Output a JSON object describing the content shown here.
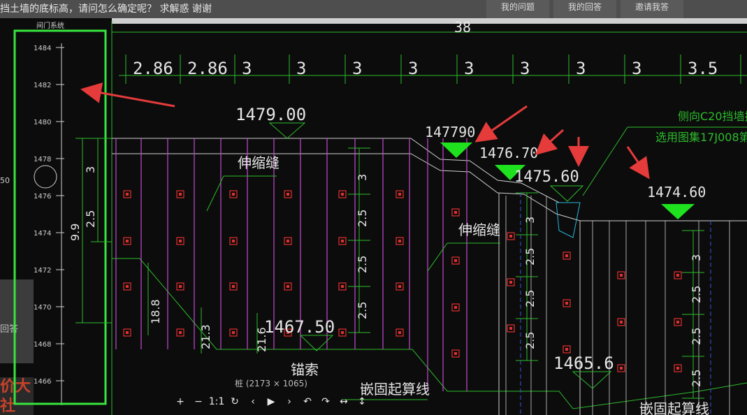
{
  "header": {
    "question": "挡土墙的底标高，请问怎么确定呢？ 求解惑 谢谢",
    "buttons": [
      "我的问题",
      "我的回答",
      "邀请我答"
    ]
  },
  "background_page": {
    "answer_label": "回答",
    "partial_title": "价大社"
  },
  "viewer": {
    "caption": "桩 (2173 × 1065)",
    "toolbar": [
      {
        "icon": "zoom-in-icon",
        "glyph": "+"
      },
      {
        "icon": "zoom-out-icon",
        "glyph": "−"
      },
      {
        "icon": "actual-size-icon",
        "glyph": "1:1"
      },
      {
        "icon": "reset-icon",
        "glyph": "↻"
      },
      {
        "icon": "previous-icon",
        "glyph": "‹"
      },
      {
        "icon": "play-icon",
        "glyph": "▶"
      },
      {
        "icon": "next-icon",
        "glyph": "›"
      },
      {
        "icon": "rotate-left-icon",
        "glyph": "↶"
      },
      {
        "icon": "rotate-right-icon",
        "glyph": "↷"
      },
      {
        "icon": "flip-horizontal-icon",
        "glyph": "↔"
      },
      {
        "icon": "flip-vertical-icon",
        "glyph": "↕"
      }
    ]
  },
  "drawing": {
    "top_label": "38",
    "top_dims": [
      "2.86",
      "2.86",
      "3",
      "3",
      "3",
      "3",
      "3",
      "3",
      "3",
      "3",
      "3.5"
    ],
    "left_label": "间门系统",
    "left_scale": [
      "1484",
      "1482",
      "1480",
      "1478",
      "1476",
      "1474",
      "1472",
      "1470",
      "1468",
      "1466"
    ],
    "elevations": [
      "1479.00",
      "147790",
      "1476.70",
      "1475.60",
      "1474.60",
      "1467.50",
      "1465.6"
    ],
    "labels": {
      "expansion_joint_1": "伸缩缝",
      "expansion_joint_2": "伸缩缝",
      "anchor": "锚索",
      "embed_line_1": "嵌固起算线",
      "embed_line_2": "嵌固起算线",
      "note_1": "侧向C20挡墙拱",
      "note_2": "选用图集17J008第",
      "left_vertical_dims": [
        "3",
        "2.5",
        "9.9"
      ],
      "bottom_vertical_dims": [
        "18.8",
        "21.3",
        "21.6"
      ],
      "mid_dims": [
        "3",
        "2.5",
        "2.5",
        "2.5"
      ],
      "right_dims": [
        "3",
        "2.5",
        "2.5",
        "2.5"
      ],
      "far_right_dims": [
        "3",
        "2.5",
        "2.5",
        "2.5"
      ],
      "left_small": "50"
    },
    "colors": {
      "highlight": "#37e63c",
      "arrow": "#e53b3b",
      "dim_green": "#2dbb2d",
      "magenta": "#c24bd0",
      "pile_red": "#e03030",
      "triangle": "#1fe21f"
    }
  }
}
